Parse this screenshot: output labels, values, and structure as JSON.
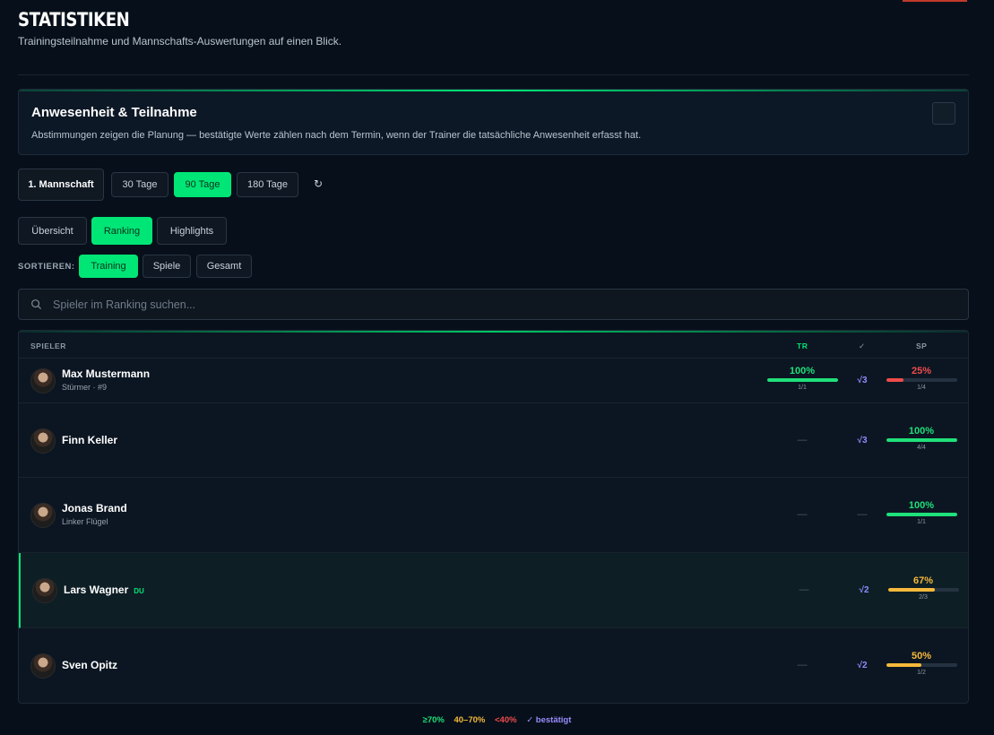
{
  "page": {
    "title": "STATISTIKEN",
    "subtitle": "Trainingsteilnahme und Mannschafts-Auswertungen auf einen Blick."
  },
  "info": {
    "title": "Anwesenheit & Teilnahme",
    "text": "Abstimmungen zeigen die Planung — bestätigte Werte zählen nach dem Termin, wenn der Trainer die tatsächliche Anwesenheit erfasst hat."
  },
  "filters": {
    "team": "1. Mannschaft",
    "periods": [
      "30 Tage",
      "90 Tage",
      "180 Tage"
    ],
    "active_period": "90 Tage",
    "refresh_icon": "↻"
  },
  "views": {
    "tabs": [
      "Übersicht",
      "Ranking",
      "Highlights"
    ],
    "active": "Ranking"
  },
  "sort": {
    "label": "SORTIEREN:",
    "options": [
      "Training",
      "Spiele",
      "Gesamt"
    ],
    "active": "Training"
  },
  "search": {
    "placeholder": "Spieler im Ranking suchen...",
    "value": ""
  },
  "table": {
    "headers": {
      "player": "SPIELER",
      "training": "TR",
      "confirmed": "✓",
      "games": "SP"
    },
    "rows": [
      {
        "name": "Max Mustermann",
        "sub": "Stürmer · #9",
        "badge": "",
        "tr_pct": "100%",
        "tr_frac": "1/1",
        "tr_value": 100,
        "conf": "√3",
        "sp_pct": "25%",
        "sp_frac": "1/4",
        "sp_value": 25
      },
      {
        "name": "Finn Keller",
        "sub": "",
        "badge": "",
        "tr_pct": "",
        "tr_frac": "",
        "tr_value": null,
        "conf": "√3",
        "sp_pct": "100%",
        "sp_frac": "4/4",
        "sp_value": 100
      },
      {
        "name": "Jonas Brand",
        "sub": "Linker Flügel",
        "badge": "",
        "tr_pct": "",
        "tr_frac": "",
        "tr_value": null,
        "conf": "",
        "sp_pct": "100%",
        "sp_frac": "1/1",
        "sp_value": 100
      },
      {
        "name": "Lars Wagner",
        "sub": "",
        "badge": "DU",
        "tr_pct": "",
        "tr_frac": "",
        "tr_value": null,
        "conf": "√2",
        "sp_pct": "67%",
        "sp_frac": "2/3",
        "sp_value": 67
      },
      {
        "name": "Sven Opitz",
        "sub": "",
        "badge": "",
        "tr_pct": "",
        "tr_frac": "",
        "tr_value": null,
        "conf": "√2",
        "sp_pct": "50%",
        "sp_frac": "1/2",
        "sp_value": 50
      }
    ],
    "dash": "—"
  },
  "legend": {
    "high": "≥70%",
    "mid": "40–70%",
    "low": "<40%",
    "confirmed": "✓ bestätigt"
  },
  "colors": {
    "high": "#1fe07a",
    "mid": "#f5b93b",
    "low": "#ef4b4b",
    "confirmed": "#9a8cff",
    "accent": "#00e676"
  }
}
